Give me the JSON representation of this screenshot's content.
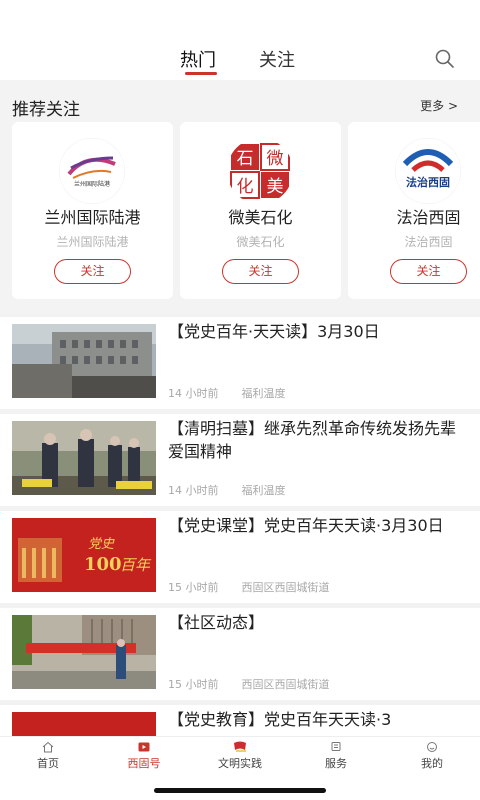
{
  "header": {
    "tabs": [
      {
        "label": "热门",
        "active": true
      },
      {
        "label": "关注",
        "active": false
      }
    ],
    "search_icon": "search-icon"
  },
  "recommend": {
    "title": "推荐关注",
    "more": "更多 >",
    "cards": [
      {
        "name": "兰州国际陆港",
        "sub": "兰州国际陆港",
        "follow": "关注",
        "logo_text": "兰州国际陆港"
      },
      {
        "name": "微美石化",
        "sub": "微美石化",
        "follow": "关注",
        "logo_text": [
          "石",
          "微",
          "化",
          "美"
        ]
      },
      {
        "name": "法治西固",
        "sub": "法治西固",
        "follow": "关注",
        "logo_text": "法治西固"
      }
    ]
  },
  "news": [
    {
      "title": "【党史百年·天天读】3月30日",
      "time": "14 小时前",
      "source": "福利温度"
    },
    {
      "title": "【清明扫墓】继承先烈革命传统发扬先辈爱国精神",
      "time": "14 小时前",
      "source": "福利温度"
    },
    {
      "title": "【党史课堂】党史百年天天读·3月30日",
      "time": "15 小时前",
      "source": "西固区西固城街道",
      "thumb_text": [
        "党史",
        "100",
        "百年"
      ]
    },
    {
      "title": "【社区动态】",
      "time": "15 小时前",
      "source": "西固区西固城街道"
    },
    {
      "title": "【党史教育】党史百年天天读·3",
      "time": "",
      "source": ""
    }
  ],
  "bottom_nav": [
    {
      "label": "首页",
      "icon": "home-icon",
      "active": false
    },
    {
      "label": "西固号",
      "icon": "play-icon",
      "active": true
    },
    {
      "label": "文明实践",
      "icon": "flag-icon",
      "active": false
    },
    {
      "label": "服务",
      "icon": "service-icon",
      "active": false
    },
    {
      "label": "我的",
      "icon": "profile-icon",
      "active": false
    }
  ],
  "colors": {
    "accent": "#c9342b",
    "background": "#f2f2f2"
  }
}
